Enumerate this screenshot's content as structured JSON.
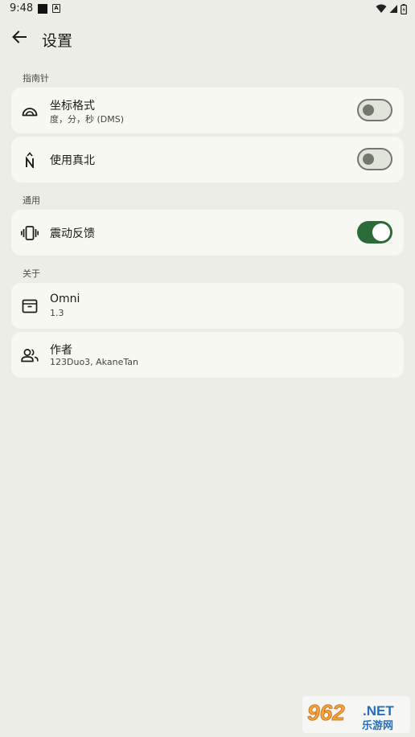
{
  "status_bar": {
    "time": "9:48",
    "icons": [
      "notification-square-icon",
      "notification-a-icon",
      "wifi-icon",
      "signal-icon",
      "battery-icon"
    ]
  },
  "app_bar": {
    "back_icon": "arrow-back-icon",
    "title": "设置"
  },
  "sections": {
    "compass": {
      "header": "指南针",
      "items": [
        {
          "icon": "gauge-arc-icon",
          "title": "坐标格式",
          "subtitle": "度，分，秒 (DMS)",
          "toggle_on": false
        },
        {
          "icon": "north-n-icon",
          "title": "使用真北",
          "toggle_on": false
        }
      ]
    },
    "general": {
      "header": "通用",
      "items": [
        {
          "icon": "vibration-icon",
          "title": "震动反馈",
          "toggle_on": true
        }
      ]
    },
    "about": {
      "header": "关于",
      "items": [
        {
          "icon": "inventory-box-icon",
          "title": "Omni",
          "subtitle": "1.3"
        },
        {
          "icon": "people-icon",
          "title": "作者",
          "subtitle": "123Duo3, AkaneTan"
        }
      ]
    }
  },
  "watermark": {
    "number": "962",
    "suffix": ".NET",
    "caption": "乐游网"
  },
  "colors": {
    "background": "#ecede7",
    "card": "#f6f8f1",
    "toggle_on": "#2d6a3a",
    "toggle_off_outline": "#73776d"
  }
}
